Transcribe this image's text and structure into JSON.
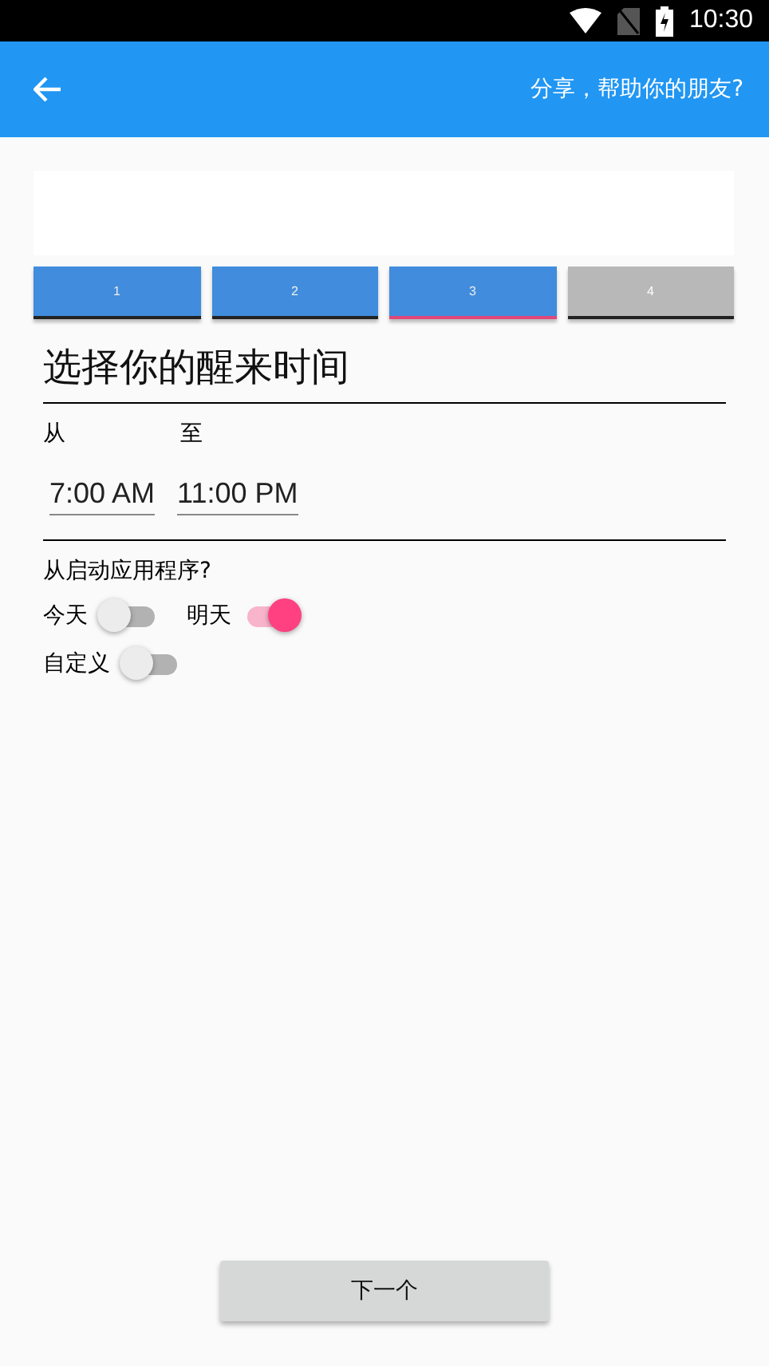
{
  "status_bar": {
    "time": "10:30"
  },
  "app_bar": {
    "action": "分享，帮助你的朋友?"
  },
  "steps": [
    {
      "label": "1",
      "reached": true,
      "selected": false
    },
    {
      "label": "2",
      "reached": true,
      "selected": false
    },
    {
      "label": "3",
      "reached": true,
      "selected": true
    },
    {
      "label": "4",
      "reached": false,
      "selected": false
    }
  ],
  "title": "选择你的醒来时间",
  "time_range": {
    "from_label": "从",
    "to_label": "至",
    "from_value": "7:00 AM",
    "to_value": "11:00 PM"
  },
  "question": "从启动应用程序?",
  "switches": [
    {
      "label": "今天",
      "on": false
    },
    {
      "label": "明天",
      "on": true
    },
    {
      "label": "自定义",
      "on": false
    }
  ],
  "next_button": "下一个"
}
